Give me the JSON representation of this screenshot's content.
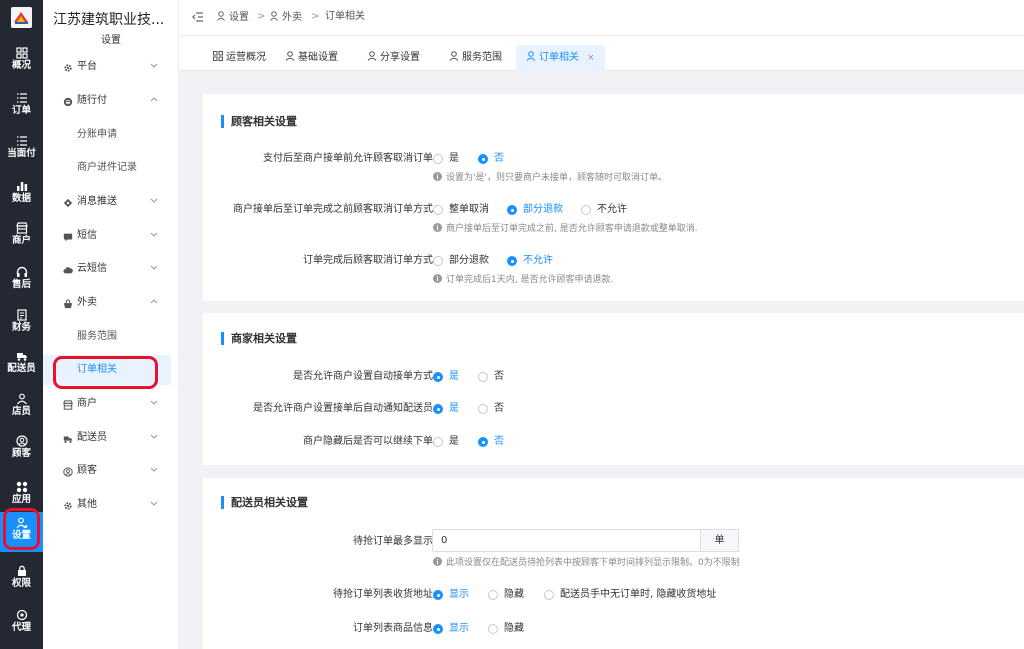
{
  "rail": [
    {
      "label": "概况",
      "icon": "overview-icon"
    },
    {
      "label": "订单",
      "icon": "list-icon"
    },
    {
      "label": "当面付",
      "icon": "list-icon"
    },
    {
      "label": "数据",
      "icon": "bar-chart-icon"
    },
    {
      "label": "商户",
      "icon": "shop-icon"
    },
    {
      "label": "售后",
      "icon": "headset-icon"
    },
    {
      "label": "财务",
      "icon": "finance-icon"
    },
    {
      "label": "配送员",
      "icon": "truck-icon"
    },
    {
      "label": "店员",
      "icon": "staff-icon"
    },
    {
      "label": "顾客",
      "icon": "customer-icon"
    },
    {
      "label": "应用",
      "icon": "apps-icon"
    },
    {
      "label": "设置",
      "icon": "settings-user-icon"
    },
    {
      "label": "权限",
      "icon": "lock-icon"
    },
    {
      "label": "代理",
      "icon": "agent-icon"
    }
  ],
  "panel": {
    "school": "江苏建筑职业技...",
    "subtitle": "设置",
    "menu": [
      {
        "label": "平台",
        "icon": "gear-icon",
        "type": "group",
        "expanded": false
      },
      {
        "label": "随行付",
        "icon": "pay-icon",
        "type": "group",
        "expanded": true
      },
      {
        "label": "分账申请",
        "type": "sub"
      },
      {
        "label": "商户进件记录",
        "type": "sub"
      },
      {
        "label": "消息推送",
        "icon": "message-icon",
        "type": "group",
        "expanded": false
      },
      {
        "label": "短信",
        "icon": "sms-icon",
        "type": "group",
        "expanded": false
      },
      {
        "label": "云短信",
        "icon": "cloud-icon",
        "type": "group",
        "expanded": false
      },
      {
        "label": "外卖",
        "icon": "takeout-icon",
        "type": "group",
        "expanded": true
      },
      {
        "label": "服务范围",
        "type": "sub"
      },
      {
        "label": "订单相关",
        "type": "sub",
        "active": true
      },
      {
        "label": "商户",
        "icon": "shop-icon",
        "type": "group",
        "expanded": false
      },
      {
        "label": "配送员",
        "icon": "truck-icon",
        "type": "group",
        "expanded": false
      },
      {
        "label": "顾客",
        "icon": "customer-icon",
        "type": "group",
        "expanded": false
      },
      {
        "label": "其他",
        "icon": "gear-icon",
        "type": "group",
        "expanded": false
      }
    ]
  },
  "breadcrumb": [
    "设置",
    "外卖",
    "订单相关"
  ],
  "tabs": [
    {
      "label": "运营概况",
      "icon": "overview-icon"
    },
    {
      "label": "基础设置",
      "icon": "user-icon"
    },
    {
      "label": "分享设置",
      "icon": "user-icon"
    },
    {
      "label": "服务范围",
      "icon": "user-icon"
    },
    {
      "label": "订单相关",
      "icon": "user-icon",
      "active": true,
      "close": "×"
    }
  ],
  "sections": {
    "customer": {
      "title": "顾客相关设置",
      "rows": [
        {
          "label": "支付后至商户接单前允许顾客取消订单",
          "options": [
            "是",
            "否"
          ],
          "selected": 1,
          "hint": "设置为'是'，则只要商户未接单，顾客随时可取消订单。"
        },
        {
          "label": "商户接单后至订单完成之前顾客取消订单方式",
          "options": [
            "整单取消",
            "部分退款",
            "不允许"
          ],
          "selected": 1,
          "hint": "商户接单后至订单完成之前, 是否允许顾客申请退款或整单取消."
        },
        {
          "label": "订单完成后顾客取消订单方式",
          "options": [
            "部分退款",
            "不允许"
          ],
          "selected": 1,
          "hint": "订单完成后1天内, 是否允许顾客申请退款."
        }
      ]
    },
    "merchant": {
      "title": "商家相关设置",
      "rows": [
        {
          "label": "是否允许商户设置自动接单方式",
          "options": [
            "是",
            "否"
          ],
          "selected": 0
        },
        {
          "label": "是否允许商户设置接单后自动通知配送员",
          "options": [
            "是",
            "否"
          ],
          "selected": 0
        },
        {
          "label": "商户隐藏后是否可以继续下单",
          "options": [
            "是",
            "否"
          ],
          "selected": 1
        }
      ]
    },
    "courier": {
      "title": "配送员相关设置",
      "max_label": "待抢订单最多显示",
      "max_value": "0",
      "max_unit": "单",
      "max_hint": "此项设置仅在配送员待抢列表中按顾客下单时间排列显示限制。0为不限制",
      "rows": [
        {
          "label": "待抢订单列表收货地址",
          "options": [
            "显示",
            "隐藏",
            "配送员手中无订单时, 隐藏收货地址"
          ],
          "selected": 0
        },
        {
          "label": "订单列表商品信息",
          "options": [
            "显示",
            "隐藏"
          ],
          "selected": 0
        }
      ]
    }
  }
}
